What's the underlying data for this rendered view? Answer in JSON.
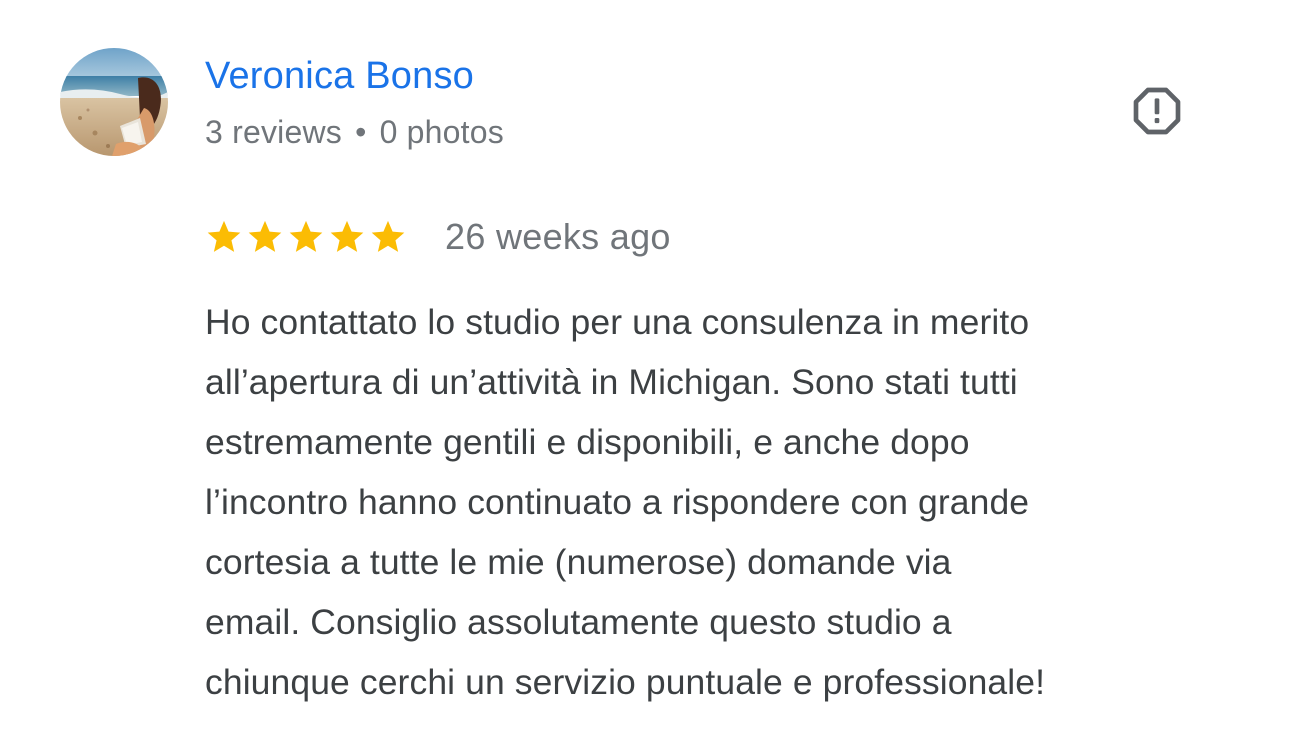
{
  "reviewer": {
    "name": "Veronica Bonso",
    "reviews_count": "3 reviews",
    "separator": "•",
    "photos_count": "0 photos"
  },
  "review": {
    "rating": 5,
    "rating_max": 5,
    "date": "26 weeks ago",
    "text_lines": [
      "Ho contattato lo studio per una consulenza in merito",
      "all’apertura di un’attività in Michigan. Sono stati tutti",
      "estremamente gentili e disponibili, e anche dopo",
      "l’incontro hanno continuato a rispondere con grande",
      "cortesia a tutte le mie (numerose) domande via",
      "email. Consiglio assolutamente questo studio a",
      "chiunque cerchi un servizio puntuale e professionale!"
    ]
  },
  "icons": {
    "report": "report-flag-icon",
    "star": "star-icon"
  },
  "colors": {
    "name_link": "#1a73e8",
    "secondary_text": "#70757a",
    "body_text": "#3c4043",
    "star": "#fbbc04",
    "report_icon": "#5f6368"
  }
}
